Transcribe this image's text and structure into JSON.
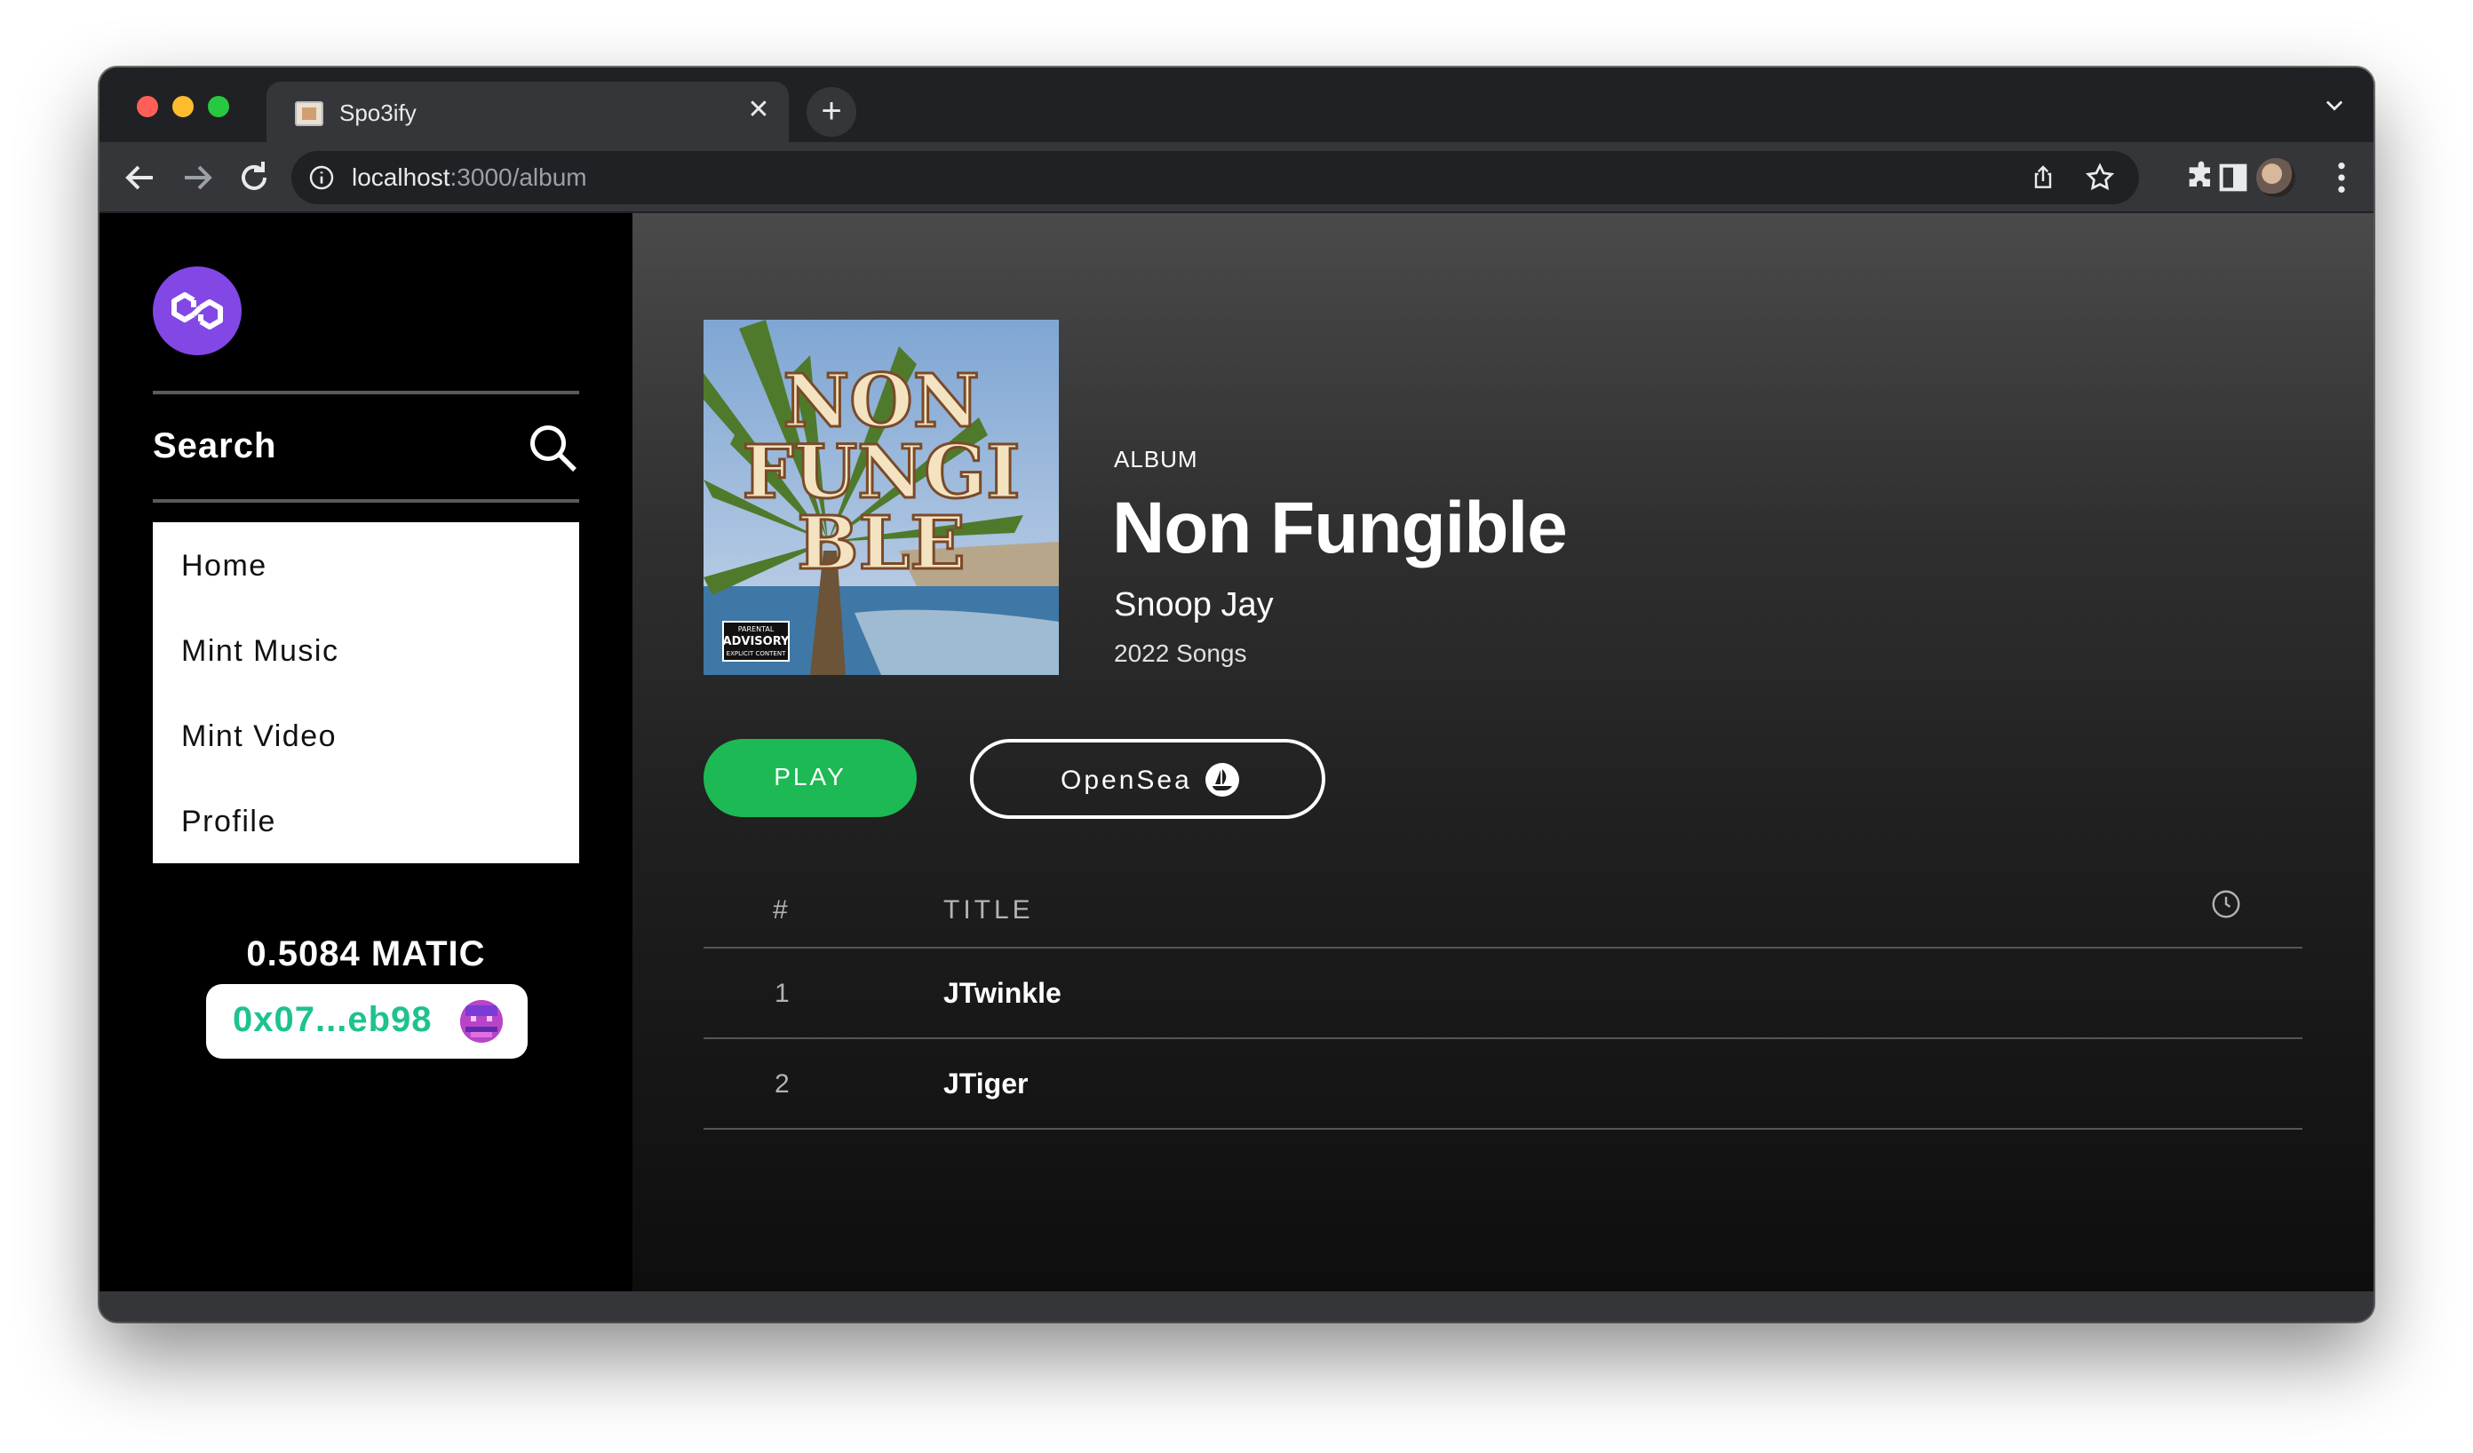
{
  "browser": {
    "tab_title": "Spo3ify",
    "url_host": "localhost",
    "url_rest": ":3000/album"
  },
  "sidebar": {
    "search_label": "Search",
    "nav": [
      {
        "label": "Home"
      },
      {
        "label": "Mint Music"
      },
      {
        "label": "Mint Video"
      },
      {
        "label": "Profile"
      }
    ],
    "balance": "0.5084 MATIC",
    "wallet_address": "0x07...eb98"
  },
  "album": {
    "type_label": "ALBUM",
    "title": "Non Fungible",
    "artist": "Snoop Jay",
    "subtitle": "2022 Songs",
    "cover_text": [
      "NON",
      "FUNGI",
      "BLE"
    ],
    "cover_badge": [
      "PARENTAL",
      "ADVISORY",
      "EXPLICIT CONTENT"
    ]
  },
  "actions": {
    "play_label": "PLAY",
    "opensea_label": "OpenSea"
  },
  "tracks": {
    "header_num": "#",
    "header_title": "TITLE",
    "rows": [
      {
        "num": "1",
        "title": "JTwinkle"
      },
      {
        "num": "2",
        "title": "JTiger"
      }
    ]
  },
  "colors": {
    "accent_green": "#1db954",
    "wallet_green": "#1dc28f",
    "polygon_purple": "#8247e5"
  }
}
